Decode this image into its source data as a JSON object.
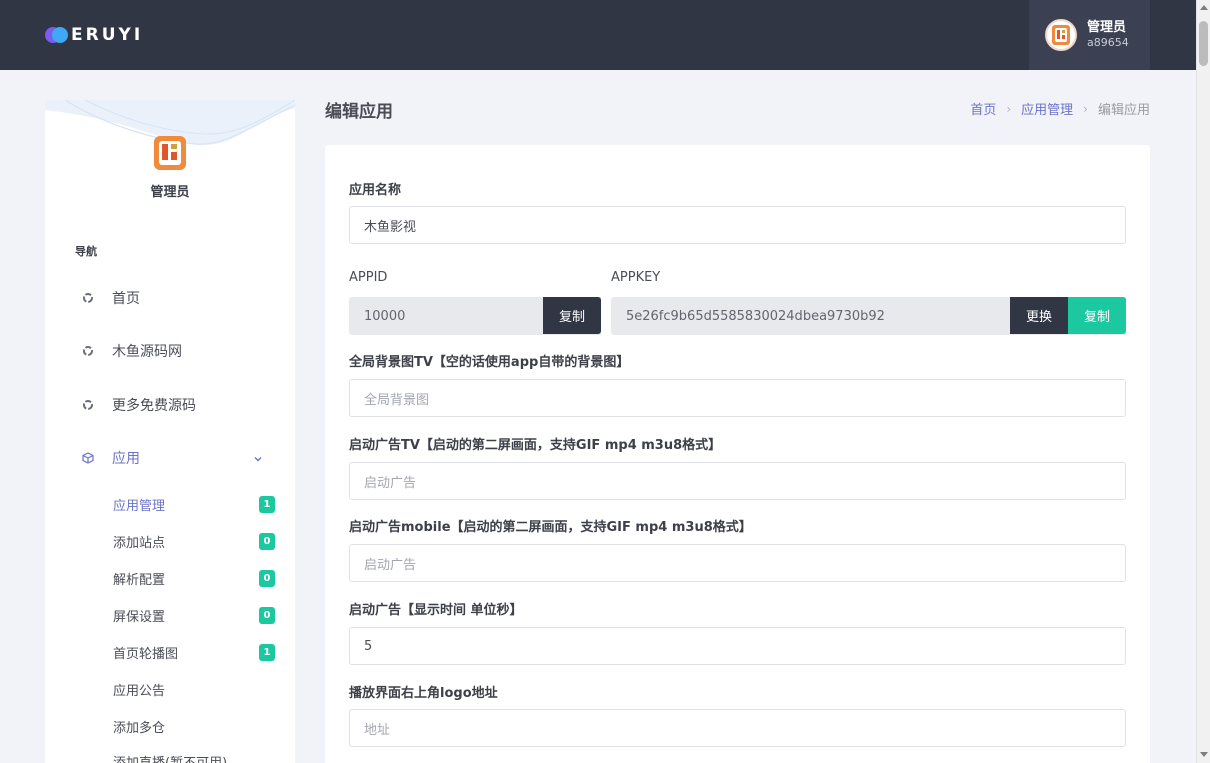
{
  "header": {
    "logo_text": "ERUYI",
    "user_name": "管理员",
    "user_id": "a89654"
  },
  "sidebar": {
    "profile_name": "管理员",
    "nav_heading": "导航",
    "items": [
      {
        "label": "首页"
      },
      {
        "label": "木鱼源码网"
      },
      {
        "label": "更多免费源码"
      },
      {
        "label": "应用"
      }
    ],
    "sub_items": [
      {
        "label": "应用管理",
        "badge": "1"
      },
      {
        "label": "添加站点",
        "badge": "0"
      },
      {
        "label": "解析配置",
        "badge": "0"
      },
      {
        "label": "屏保设置",
        "badge": "0"
      },
      {
        "label": "首页轮播图",
        "badge": "1"
      },
      {
        "label": "应用公告",
        "badge": ""
      },
      {
        "label": "添加多仓",
        "badge": ""
      },
      {
        "label": "添加直播(暂不可用)",
        "badge": ""
      }
    ]
  },
  "page": {
    "title": "编辑应用",
    "breadcrumb": [
      "首页",
      "应用管理",
      "编辑应用"
    ]
  },
  "form": {
    "app_name_label": "应用名称",
    "app_name_value": "木鱼影视",
    "appid_label": "APPID",
    "appid_value": "10000",
    "appid_copy": "复制",
    "appkey_label": "APPKEY",
    "appkey_value": "5e26fc9b65d5585830024dbea9730b92",
    "appkey_change": "更换",
    "appkey_copy": "复制",
    "bg_label": "全局背景图TV【空的话使用app自带的背景图】",
    "bg_placeholder": "全局背景图",
    "ad_tv_label": "启动广告TV【启动的第二屏画面，支持GIF mp4 m3u8格式】",
    "ad_tv_placeholder": "启动广告",
    "ad_mobile_label": "启动广告mobile【启动的第二屏画面，支持GIF mp4 m3u8格式】",
    "ad_mobile_placeholder": "启动广告",
    "ad_time_label": "启动广告【显示时间 单位秒】",
    "ad_time_value": "5",
    "logo_label": "播放界面右上角logo地址",
    "logo_placeholder": "地址"
  },
  "colors": {
    "topbar": "#313644",
    "accent": "#6b73c8",
    "green": "#1cc8a0"
  }
}
